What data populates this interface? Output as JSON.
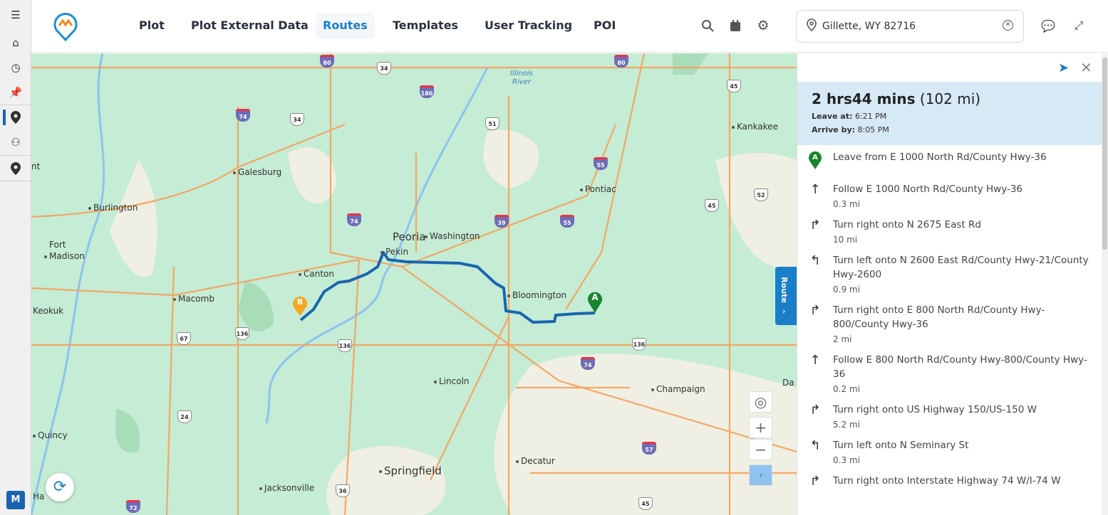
{
  "rail": {
    "items": [
      "menu-icon",
      "home-icon",
      "history-icon",
      "pin-icon",
      "location-icon",
      "network-icon",
      "location-icon"
    ],
    "avatar": "M"
  },
  "header": {
    "nav": [
      "Plot",
      "Plot External Data",
      "Routes",
      "Templates",
      "User Tracking",
      "POI"
    ],
    "active": "Routes",
    "search": {
      "value": "Gillette, WY 82716"
    }
  },
  "map": {
    "cities": [
      "Galesburg",
      "Burlington",
      "Fort",
      "Madison",
      "Keokuk",
      "Macomb",
      "Canton",
      "Peoria",
      "Washington",
      "Pekin",
      "Bloomington",
      "Pontiac",
      "Kankakee",
      "Lincoln",
      "Champaign",
      "Quincy",
      "Springfield",
      "Decatur",
      "Jacksonville",
      "Ha",
      "nt",
      "Da"
    ],
    "river": "Illinois River",
    "river1": "Illinois",
    "river2": "River",
    "shields": [
      "80",
      "34",
      "180",
      "74",
      "34",
      "51",
      "55",
      "52",
      "45",
      "74",
      "39",
      "55",
      "136",
      "67",
      "136",
      "74",
      "136",
      "24",
      "57",
      "36",
      "72",
      "45",
      "80",
      "45"
    ],
    "markers": {
      "start": "A",
      "end": "B"
    },
    "route_color": "#1a65b0",
    "route_tab": "Route"
  },
  "panel": {
    "duration": "2 hrs44 mins",
    "distance": "(102 mi)",
    "leave_label": "Leave at:",
    "leave": "6:21 PM",
    "arrive_label": "Arrive by:",
    "arrive": "8:05 PM",
    "steps": [
      {
        "icon": "start-marker",
        "text": "Leave from E 1000 North Rd/County Hwy-36",
        "dist": ""
      },
      {
        "icon": "straight",
        "text": "Follow E 1000 North Rd/County Hwy-36",
        "dist": "0.3 mi"
      },
      {
        "icon": "right",
        "text": "Turn right onto N 2675 East Rd",
        "dist": "10 mi"
      },
      {
        "icon": "left",
        "text": "Turn left onto N 2600 East Rd/County Hwy-21/County Hwy-2600",
        "dist": "0.9 mi"
      },
      {
        "icon": "right",
        "text": "Turn right onto E 800 North Rd/County Hwy-800/County Hwy-36",
        "dist": "2 mi"
      },
      {
        "icon": "straight",
        "text": "Follow E 800 North Rd/County Hwy-800/County Hwy-36",
        "dist": "0.2 mi"
      },
      {
        "icon": "right",
        "text": "Turn right onto US Highway 150/US-150 W",
        "dist": "5.2 mi"
      },
      {
        "icon": "left",
        "text": "Turn left onto N Seminary St",
        "dist": "0.3 mi"
      },
      {
        "icon": "right",
        "text": "Turn right onto Interstate Highway 74 W/I-74 W",
        "dist": ""
      }
    ]
  }
}
